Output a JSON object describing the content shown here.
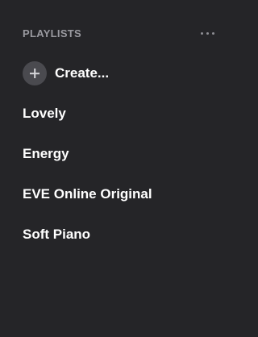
{
  "sidebar": {
    "header": {
      "title": "PLAYLISTS",
      "more_icon": "ellipsis-horizontal-icon"
    },
    "create": {
      "icon": "plus-icon",
      "label": "Create..."
    },
    "playlists": [
      {
        "label": "Lovely"
      },
      {
        "label": "Energy"
      },
      {
        "label": "EVE Online Original"
      },
      {
        "label": "Soft Piano"
      }
    ]
  },
  "colors": {
    "background": "#252528",
    "header_text": "#9a9aa0",
    "item_text": "#ffffff",
    "plus_circle": "#4a4a4f"
  }
}
